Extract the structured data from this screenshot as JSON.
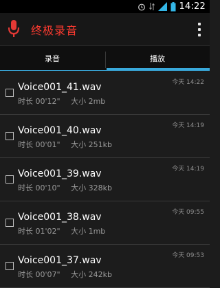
{
  "status": {
    "time": "14:22"
  },
  "app": {
    "title": "终极录音"
  },
  "tabs": [
    {
      "label": "录音",
      "selected": false
    },
    {
      "label": "播放",
      "selected": true
    }
  ],
  "colors": {
    "accent": "#39a9db",
    "title": "#ff3b30"
  },
  "recordings": [
    {
      "name": "Voice001_41.wav",
      "duration_label": "时长",
      "duration": "00'12\"",
      "size_label": "大小",
      "size": "2mb",
      "time": "今天 14:22"
    },
    {
      "name": "Voice001_40.wav",
      "duration_label": "时长",
      "duration": "00'01\"",
      "size_label": "大小",
      "size": "251kb",
      "time": "今天 14:19"
    },
    {
      "name": "Voice001_39.wav",
      "duration_label": "时长",
      "duration": "00'10\"",
      "size_label": "大小",
      "size": "328kb",
      "time": "今天 14:19"
    },
    {
      "name": "Voice001_38.wav",
      "duration_label": "时长",
      "duration": "01'02\"",
      "size_label": "大小",
      "size": "1mb",
      "time": "今天 09:55"
    },
    {
      "name": "Voice001_37.wav",
      "duration_label": "时长",
      "duration": "00'07\"",
      "size_label": "大小",
      "size": "242kb",
      "time": "今天 09:53"
    }
  ]
}
